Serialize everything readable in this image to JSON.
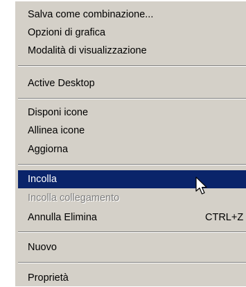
{
  "menu": {
    "items": [
      {
        "label": "Salva come combinazione..."
      },
      {
        "label": "Opzioni di grafica"
      },
      {
        "label": "Modalità di visualizzazione"
      },
      {
        "label": "Active Desktop"
      },
      {
        "label": "Disponi icone"
      },
      {
        "label": "Allinea icone"
      },
      {
        "label": "Aggiorna"
      },
      {
        "label": "Incolla"
      },
      {
        "label": "Incolla collegamento"
      },
      {
        "label": "Annulla Elimina",
        "shortcut": "CTRL+Z"
      },
      {
        "label": "Nuovo"
      },
      {
        "label": "Proprietà"
      }
    ]
  },
  "icons": {
    "submenu": "chevron-right-icon",
    "cursor": "mouse-pointer-icon"
  },
  "colors": {
    "menu_bg": "#d4d0c8",
    "highlight_bg": "#0a246a",
    "highlight_text": "#ffffff",
    "disabled_text": "#808080"
  }
}
